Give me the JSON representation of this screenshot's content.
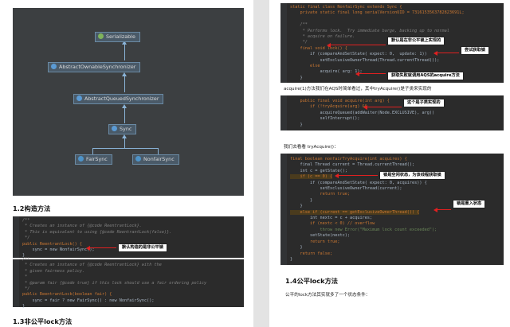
{
  "left": {
    "diagram": {
      "serializable": "Serializable",
      "abstract_ownable": "AbstractOwnableSynchronizer",
      "abstract_queued": "AbstractQueuedSynchronizer",
      "sync": "Sync",
      "fair_sync": "FairSync",
      "nonfair_sync": "NonfairSync"
    },
    "heading_constructor": "1.2构造方法",
    "code1": [
      "/**",
      " * Creates an instance of {@code ReentrantLock}.",
      " * This is equivalent to using {@code ReentrantLock(false)}.",
      " */",
      "public ReentrantLock() {",
      "    sync = new NonfairSync();",
      "}"
    ],
    "callout_default": "默认构造的是非公平锁",
    "code2": [
      "/**",
      " * Creates an instance of {@code ReentrantLock} with the",
      " * given fairness policy.",
      " *",
      " * @param fair {@code true} if this lock should use a fair ordering policy",
      " */",
      "public ReentrantLock(boolean fair) {",
      "    sync = fair ? new FairSync() : new NonfairSync();",
      "}"
    ],
    "heading_nonfair": "1.3非公平lock方法"
  },
  "right": {
    "code_top": [
      "static final class NonfairSync extends Sync {",
      "    private static final long serialVersionUID = 7316153563782823691L;",
      "",
      "    /**",
      "     * Performs lock.  Try immediate barge, backing up to normal",
      "     * acquire on failure.",
      "     */",
      "    final void lock() {",
      "        if (compareAndSetState( expect: 0,  update: 1))",
      "            setExclusiveOwnerThread(Thread.currentThread());",
      "        else",
      "            acquire( arg: 1);",
      "    }"
    ],
    "callout_nonfair_impl": "默认是在非公平锁上实现的",
    "callout_try_lock": "尝试获取锁",
    "callout_acquire_fail": "获取失败就调用AQS的acquire方法",
    "para_acquire": "acquire(1)方法我们在AQS时简单看过，其中tryAcquire()是子类来实现的",
    "code_acquire": [
      "    public final void acquire(int arg) {",
      "        if (!tryAcquire(arg) &&",
      "            acquireQueued(addWaiter(Node.EXCLUSIVE), arg))",
      "            selfInterrupt();",
      "    }"
    ],
    "callout_subclass": "这个是子类实现的",
    "para_look": "我们去看看 tryAcquire()：",
    "code_try": [
      "final boolean nonfairTryAcquire(int acquires) {",
      "    final Thread current = Thread.currentThread();",
      "    int c = getState();",
      "    if (c == 0) {",
      "        if (compareAndSetState( expect: 0, acquires)) {",
      "            setExclusiveOwnerThread(current);",
      "            return true;",
      "        }",
      "    }",
      "    else if (current == getExclusiveOwnerThread()) {",
      "        int nextc = c + acquires;",
      "        if (nextc < 0) // overflow",
      "            throw new Error(\"Maximum lock count exceeded\");",
      "        setState(nextc);",
      "        return true;",
      "    }",
      "    return false;",
      "}"
    ],
    "callout_free": "锁是空闲状态，为该线程获取锁",
    "callout_reentrant": "锁是重入状态",
    "heading_fair": "1.4公平lock方法",
    "para_fair": "公平的lock方法其实就多了一个状态条件："
  }
}
